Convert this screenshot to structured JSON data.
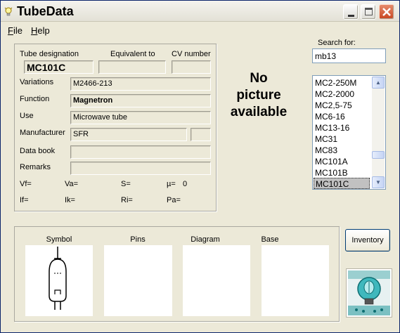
{
  "window": {
    "title": "TubeData",
    "app_icon": "light-bulb-icon",
    "controls": {
      "minimize": "minimize-icon",
      "maximize": "maximize-icon",
      "close": "close-icon"
    }
  },
  "menu": {
    "file": {
      "first": "F",
      "rest": "ile"
    },
    "help": {
      "first": "H",
      "rest": "elp"
    }
  },
  "details": {
    "designation_label": "Tube designation",
    "equivalent_label": "Equivalent to",
    "cv_label": "CV number",
    "designation_value": "MC101C",
    "equivalent_value": "",
    "cv_value": "",
    "variations_label": "Variations",
    "variations_value": "M2466-213",
    "function_label": "Function",
    "function_value": "Magnetron",
    "use_label": "Use",
    "use_value": "Microwave tube",
    "manufacturer_label": "Manufacturer",
    "manufacturer_value": "SFR",
    "manufacturer_code": "",
    "databook_label": "Data book",
    "databook_value": "",
    "remarks_label": "Remarks",
    "remarks_value": "",
    "params": {
      "vf": "Vf=",
      "va": "Va=",
      "s": "S=",
      "mu_label": "µ=",
      "mu_value": "0",
      "if": "If=",
      "ik": "Ik=",
      "ri": "Ri=",
      "pa": "Pa="
    }
  },
  "picture": {
    "line1": "No",
    "line2": "picture",
    "line3": "available"
  },
  "search": {
    "label": "Search for:",
    "value": "mb13"
  },
  "tube_list": {
    "items": [
      "MC2-250M",
      "MC2-2000",
      "MC2,5-75",
      "MC6-16",
      "MC13-16",
      "MC31",
      "MC83",
      "MC101A",
      "MC101B",
      "MC101C"
    ],
    "selected": "MC101C"
  },
  "panels": {
    "symbol": "Symbol",
    "pins": "Pins",
    "diagram": "Diagram",
    "base": "Base"
  },
  "inventory_button": "Inventory",
  "colors": {
    "window_bg": "#ece9d8",
    "logo_teal": "#0f8f93",
    "close_red": "#c94520"
  }
}
